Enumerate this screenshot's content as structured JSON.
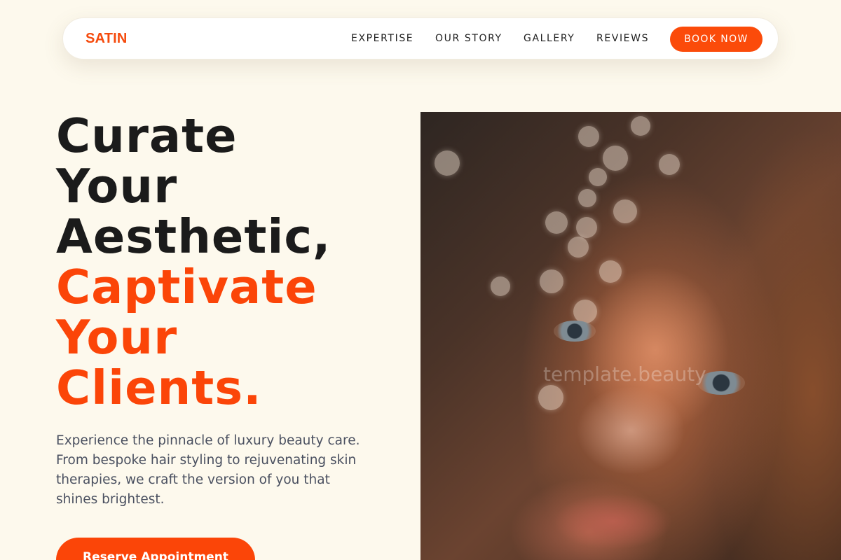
{
  "brand": {
    "name": "SATIN",
    "accent_color": "#fb4508"
  },
  "nav": {
    "links": [
      "EXPERTISE",
      "OUR STORY",
      "GALLERY",
      "REVIEWS"
    ],
    "cta": "BOOK NOW"
  },
  "hero": {
    "headline_dark": [
      "Curate",
      "Your",
      "Aesthetic,"
    ],
    "headline_accent": [
      "Captivate",
      "Your",
      "Clients."
    ],
    "description": "Experience the pinnacle of luxury beauty care. From bespoke hair styling to rejuvenating skin therapies, we craft the version of you that shines brightest.",
    "cta": "Reserve Appointment",
    "image_watermark": "template.beauty"
  }
}
